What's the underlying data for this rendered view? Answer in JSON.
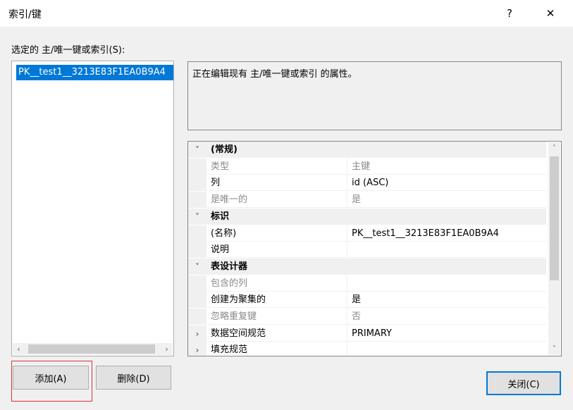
{
  "window": {
    "title": "索引/键",
    "help_label": "?",
    "close_label": "✕"
  },
  "selection_label": "选定的 主/唯一键或索引(S):",
  "list": {
    "items": [
      "PK__test1__3213E83F1EA0B9A4"
    ],
    "scroll_left": "‹",
    "scroll_right": "›"
  },
  "description": "正在编辑现有 主/唯一键或索引 的属性。",
  "properties": {
    "scroll_up": "˄",
    "scroll_down": "˅",
    "rows": [
      {
        "kind": "category",
        "expander": "˅",
        "name": "(常规)",
        "value": ""
      },
      {
        "kind": "readonly",
        "expander": "",
        "name": "类型",
        "value": "主键"
      },
      {
        "kind": "editable",
        "expander": "",
        "name": "列",
        "value": "id (ASC)"
      },
      {
        "kind": "readonly",
        "expander": "",
        "name": "是唯一的",
        "value": "是"
      },
      {
        "kind": "category",
        "expander": "˅",
        "name": "标识",
        "value": ""
      },
      {
        "kind": "editable",
        "expander": "",
        "name": "(名称)",
        "value": "PK__test1__3213E83F1EA0B9A4"
      },
      {
        "kind": "editable",
        "expander": "",
        "name": "说明",
        "value": ""
      },
      {
        "kind": "category",
        "expander": "˅",
        "name": "表设计器",
        "value": ""
      },
      {
        "kind": "readonly",
        "expander": "",
        "name": "包含的列",
        "value": ""
      },
      {
        "kind": "editable",
        "expander": "",
        "name": "创建为聚集的",
        "value": "是"
      },
      {
        "kind": "readonly",
        "expander": "",
        "name": "忽略重复键",
        "value": "否"
      },
      {
        "kind": "editable",
        "expander": "›",
        "name": "数据空间规范",
        "value": "PRIMARY"
      },
      {
        "kind": "editable",
        "expander": "›",
        "name": "填充规范",
        "value": ""
      }
    ]
  },
  "buttons": {
    "add": "添加(A)",
    "delete": "删除(D)",
    "close": "关闭(C)"
  }
}
